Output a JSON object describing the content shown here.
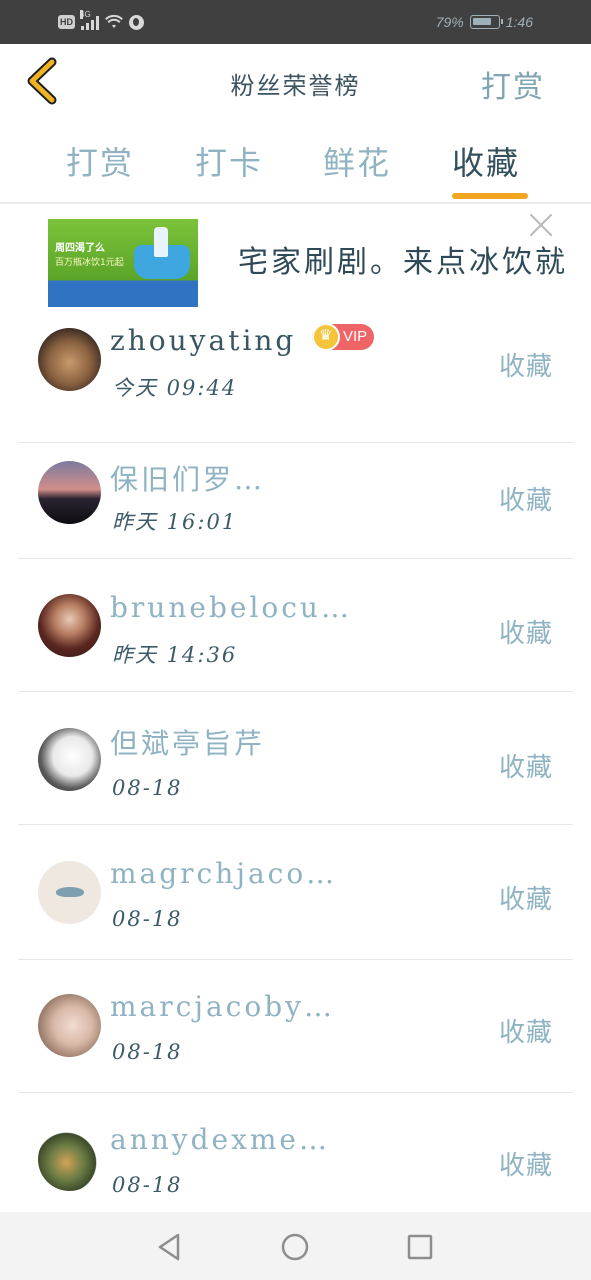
{
  "status_bar": {
    "hd": "HD",
    "network": "4G",
    "battery_percent": "79%",
    "time": "1:46"
  },
  "header": {
    "title": "粉丝荣誉榜",
    "action_label": "打赏"
  },
  "tabs": [
    {
      "label": "打赏"
    },
    {
      "label": "打卡"
    },
    {
      "label": "鲜花"
    },
    {
      "label": "收藏"
    }
  ],
  "active_tab": "收藏",
  "ad": {
    "image_line1": "周四渴了么",
    "image_line2": "百万瓶冰饮1元起",
    "text": "宅家刷剧。来点冰饮就"
  },
  "list": [
    {
      "name": "zhouyating",
      "time": "今天 09:44",
      "vip": true,
      "vip_label": "VIP",
      "action": "收藏"
    },
    {
      "name": "保旧们罗…",
      "time": "昨天 16:01",
      "vip": false,
      "action": "收藏"
    },
    {
      "name": "brunebelocu…",
      "time": "昨天 14:36",
      "vip": false,
      "action": "收藏"
    },
    {
      "name": "但斌亭旨芹",
      "time": "08-18",
      "vip": false,
      "action": "收藏"
    },
    {
      "name": "magrchjaco…",
      "time": "08-18",
      "vip": false,
      "action": "收藏"
    },
    {
      "name": "marcjacoby…",
      "time": "08-18",
      "vip": false,
      "action": "收藏"
    },
    {
      "name": "annydexme…",
      "time": "08-18",
      "vip": false,
      "action": "收藏"
    }
  ],
  "colors": {
    "accent": "#f2a51f",
    "back_arrow": "#f0b324",
    "vip": "#ef6466"
  }
}
